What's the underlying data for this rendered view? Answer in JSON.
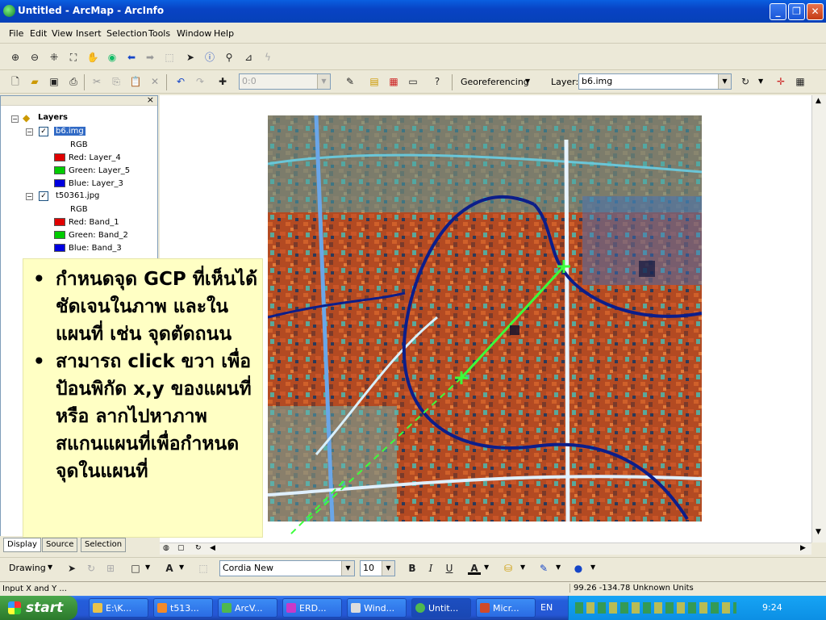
{
  "window": {
    "title": "Untitled - ArcMap - ArcInfo",
    "controls": [
      "_",
      "❐",
      "✕"
    ]
  },
  "menu": [
    "File",
    "Edit",
    "View",
    "Insert",
    "Selection",
    "Tools",
    "Window",
    "Help"
  ],
  "toolbar": {
    "scale_value": "0:0",
    "georef_label": "Georeferencing",
    "layer_label": "Layer:",
    "layer_value": "b6.img"
  },
  "toc": {
    "root": "Layers",
    "layers": [
      {
        "name": "b6.img",
        "renderer": "RGB",
        "bands": [
          {
            "label": "Red:   Layer_4",
            "color": "#e00000"
          },
          {
            "label": "Green: Layer_5",
            "color": "#00cc00"
          },
          {
            "label": "Blue:  Layer_3",
            "color": "#0000e0"
          }
        ]
      },
      {
        "name": "t50361.jpg",
        "renderer": "RGB",
        "bands": [
          {
            "label": "Red:   Band_1",
            "color": "#e00000"
          },
          {
            "label": "Green: Band_2",
            "color": "#00cc00"
          },
          {
            "label": "Blue:  Band_3",
            "color": "#0000e0"
          }
        ]
      }
    ],
    "tabs": [
      "Display",
      "Source",
      "Selection"
    ]
  },
  "overlay": {
    "bullets": [
      "กำหนดจุด GCP ที่เห็นได้ชัดเจนในภาพ และในแผนที่ เช่น จุดตัดถนน",
      "สามารถ click ขวา เพื่อป้อนพิกัด x,y ของแผนที่ หรือ ลากไปหาภาพ สแกนแผนที่เพื่อกำหนดจุดในแผนที่"
    ]
  },
  "drawing": {
    "label": "Drawing",
    "font": "Cordia New",
    "size": "10",
    "bold": "B",
    "italic": "I",
    "underline": "U",
    "fontcolor": "A"
  },
  "status": {
    "left": "Input X and Y ...",
    "right": "99.26  -134.78 Unknown Units"
  },
  "taskbar": {
    "start": "start",
    "tasks": [
      "E:\\K...",
      "t513...",
      "ArcV...",
      "ERD...",
      "Wind...",
      "Untit...",
      "Micr..."
    ],
    "lang": "EN",
    "clock": "9:24"
  },
  "colors": {
    "xp_blue": "#0843c4",
    "gcp_link": "#3bff3b",
    "road": "#e8f4ff"
  }
}
